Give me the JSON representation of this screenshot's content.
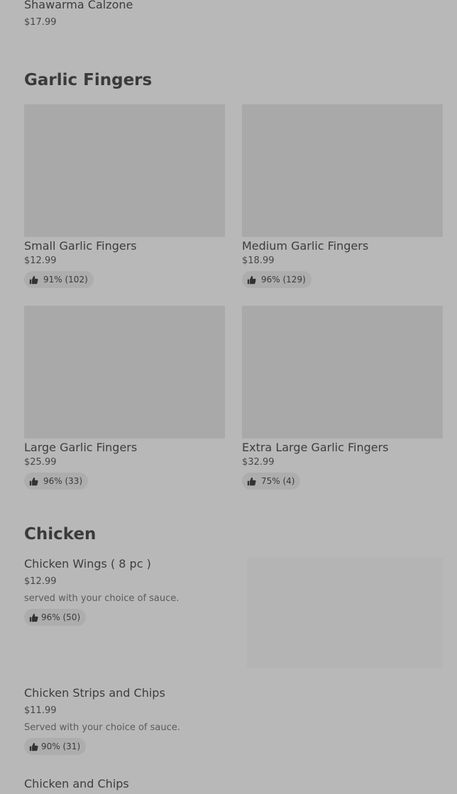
{
  "top_item": {
    "title": "Shawarma Calzone",
    "price": "$17.99"
  },
  "garlic_section": {
    "title": "Garlic Fingers",
    "items": [
      {
        "title": "Small Garlic Fingers",
        "price": "$12.99",
        "rating": "91% (102)"
      },
      {
        "title": "Medium Garlic Fingers",
        "price": "$18.99",
        "rating": "96% (129)"
      },
      {
        "title": "Large Garlic Fingers",
        "price": "$25.99",
        "rating": "96% (33)"
      },
      {
        "title": "Extra Large Garlic Fingers",
        "price": "$32.99",
        "rating": "75% (4)"
      }
    ]
  },
  "chicken_section": {
    "title": "Chicken",
    "items": [
      {
        "title": "Chicken Wings ( 8 pc )",
        "price": "$12.99",
        "description": "served with your choice of sauce.",
        "rating": "96% (50)"
      },
      {
        "title": "Chicken Strips and Chips",
        "price": "$11.99",
        "description": "Served with your choice of sauce.",
        "rating": "90% (31)"
      },
      {
        "title": "Chicken and Chips"
      }
    ]
  },
  "icons": {
    "rating": "thumbs-up-icon"
  },
  "colors": {
    "overlay_bg": "#b8b8b8",
    "image_placeholder": "#a9a9a9",
    "badge_bg": "#adadad"
  }
}
